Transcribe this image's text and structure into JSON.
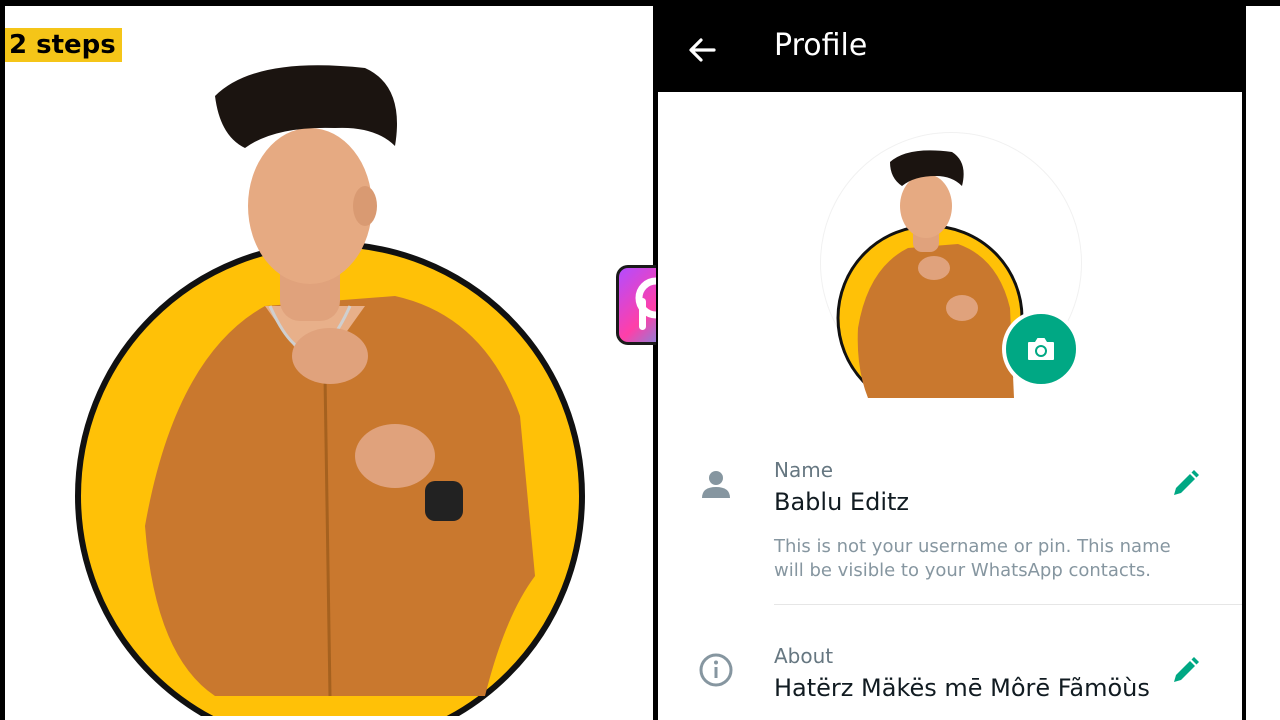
{
  "thumbnail": {
    "badge": "2 steps",
    "accent_yellow": "#FFC107"
  },
  "logo": {
    "icon": "picsart-logo-icon"
  },
  "profile_screen": {
    "title": "Profile",
    "back_icon": "arrow-back-icon",
    "camera_icon": "camera-icon",
    "accent": "#00A884",
    "name": {
      "label": "Name",
      "value": "Bablu Editz",
      "hint": "This is not your username or pin. This name will be visible to your WhatsApp contacts.",
      "icon": "person-icon",
      "edit_icon": "pencil-icon"
    },
    "about": {
      "label": "About",
      "value": "Hatërz Mäkës mē Môrē Fãmöùs",
      "icon": "info-icon",
      "edit_icon": "pencil-icon"
    }
  }
}
